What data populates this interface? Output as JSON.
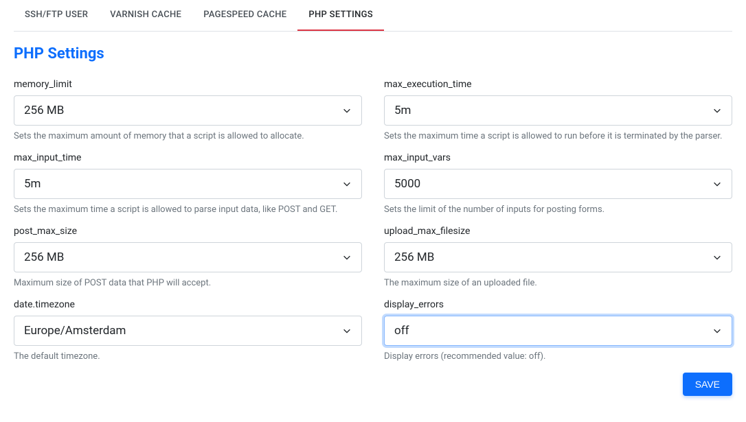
{
  "tabs": [
    {
      "label": "SSH/FTP USER",
      "active": false
    },
    {
      "label": "VARNISH CACHE",
      "active": false
    },
    {
      "label": "PAGESPEED CACHE",
      "active": false
    },
    {
      "label": "PHP SETTINGS",
      "active": true
    }
  ],
  "page_title": "PHP Settings",
  "fields": {
    "memory_limit": {
      "label": "memory_limit",
      "value": "256 MB",
      "help": "Sets the maximum amount of memory that a script is allowed to allocate."
    },
    "max_execution_time": {
      "label": "max_execution_time",
      "value": "5m",
      "help": "Sets the maximum time a script is allowed to run before it is terminated by the parser."
    },
    "max_input_time": {
      "label": "max_input_time",
      "value": "5m",
      "help": "Sets the maximum time a script is allowed to parse input data, like POST and GET."
    },
    "max_input_vars": {
      "label": "max_input_vars",
      "value": "5000",
      "help": "Sets the limit of the number of inputs for posting forms."
    },
    "post_max_size": {
      "label": "post_max_size",
      "value": "256 MB",
      "help": "Maximum size of POST data that PHP will accept."
    },
    "upload_max_filesize": {
      "label": "upload_max_filesize",
      "value": "256 MB",
      "help": "The maximum size of an uploaded file."
    },
    "date_timezone": {
      "label": "date.timezone",
      "value": "Europe/Amsterdam",
      "help": "The default timezone."
    },
    "display_errors": {
      "label": "display_errors",
      "value": "off",
      "help": "Display errors (recommended value: off).",
      "focused": true
    }
  },
  "actions": {
    "save_label": "SAVE"
  }
}
